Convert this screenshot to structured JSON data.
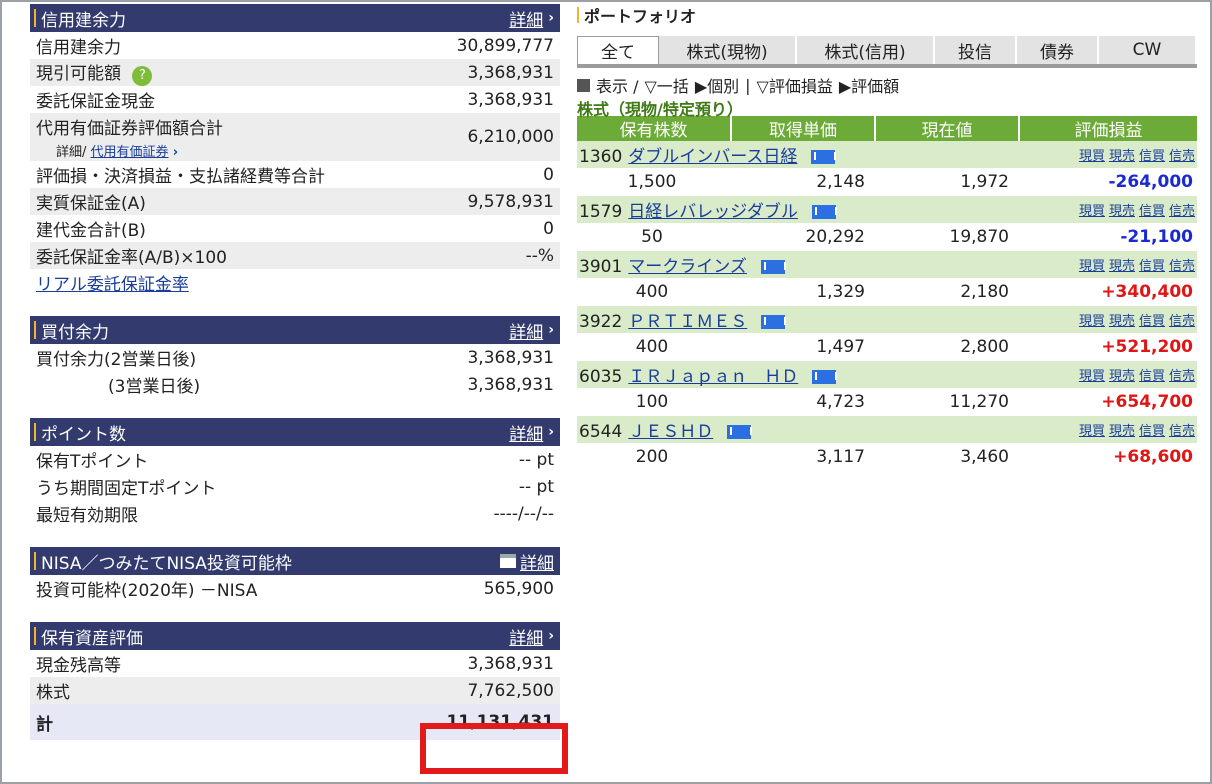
{
  "credit": {
    "title": "信用建余力",
    "detail": "詳細",
    "rows": [
      {
        "label": "信用建余力",
        "value": "30,899,777"
      },
      {
        "label": "現引可能額",
        "value": "3,368,931"
      },
      {
        "label": "委託保証金現金",
        "value": "3,368,931"
      },
      {
        "label": "代用有価証券評価額合計",
        "value": "6,210,000"
      },
      {
        "label": "評価損・決済損益・支払諸経費等合計",
        "value": "0"
      },
      {
        "label": "実質保証金(A)",
        "value": "9,578,931"
      },
      {
        "label": "建代金合計(B)",
        "value": "0"
      },
      {
        "label": "委託保証金率(A/B)×100",
        "value": "--%"
      }
    ],
    "sub_detail": "詳細/",
    "sub_link": "代用有価証券",
    "help": "?",
    "realtime_link": "リアル委託保証金率"
  },
  "buy": {
    "title": "買付余力",
    "detail": "詳細",
    "rows": [
      {
        "label": "買付余力(2営業日後)",
        "value": "3,368,931"
      },
      {
        "label": "(3営業日後)",
        "value": "3,368,931"
      }
    ]
  },
  "points": {
    "title": "ポイント数",
    "detail": "詳細",
    "rows": [
      {
        "label": "保有Tポイント",
        "value": "-- pt"
      },
      {
        "label": "うち期間固定Tポイント",
        "value": "-- pt"
      },
      {
        "label": "最短有効期限",
        "value": "----/--/--"
      }
    ]
  },
  "nisa": {
    "title": "NISA／つみたてNISA投資可能枠",
    "detail": "詳細",
    "rows": [
      {
        "label": "投資可能枠(2020年) －NISA",
        "value": "565,900"
      }
    ]
  },
  "assets": {
    "title": "保有資産評価",
    "detail": "詳細",
    "rows": [
      {
        "label": "現金残高等",
        "value": "3,368,931"
      },
      {
        "label": "株式",
        "value": "7,762,500"
      },
      {
        "label": "計",
        "value": "11,131,431"
      }
    ]
  },
  "portfolio": {
    "title": "ポートフォリオ",
    "tabs": [
      "全て",
      "株式(現物)",
      "株式(信用)",
      "投信",
      "債券",
      "CW"
    ],
    "controls": [
      "表示 /",
      "一括",
      "個別",
      "|",
      "評価損益",
      "評価額"
    ],
    "subtitle": "株式（現物/特定預り）",
    "headers": [
      "保有株数",
      "取得単価",
      "現在値",
      "評価損益"
    ],
    "actions": [
      "現買",
      "現売",
      "信買",
      "信売"
    ],
    "stocks": [
      {
        "code": "1360",
        "name": "ダブルインバース日経",
        "qty": "1,500",
        "cost": "2,148",
        "price": "1,972",
        "pl": "-264,000",
        "sign": "neg"
      },
      {
        "code": "1579",
        "name": "日経レバレッジダブル",
        "qty": "50",
        "cost": "20,292",
        "price": "19,870",
        "pl": "-21,100",
        "sign": "neg"
      },
      {
        "code": "3901",
        "name": "マークラインズ",
        "qty": "400",
        "cost": "1,329",
        "price": "2,180",
        "pl": "+340,400",
        "sign": "pos"
      },
      {
        "code": "3922",
        "name": "ＰＲＴＩＭＥＳ",
        "qty": "400",
        "cost": "1,497",
        "price": "2,800",
        "pl": "+521,200",
        "sign": "pos"
      },
      {
        "code": "6035",
        "name": "ＩＲＪａｐａｎ　ＨＤ",
        "qty": "100",
        "cost": "4,723",
        "price": "11,270",
        "pl": "+654,700",
        "sign": "pos"
      },
      {
        "code": "6544",
        "name": "ＪＥＳＨＤ",
        "qty": "200",
        "cost": "3,117",
        "price": "3,460",
        "pl": "+68,600",
        "sign": "pos"
      }
    ]
  }
}
